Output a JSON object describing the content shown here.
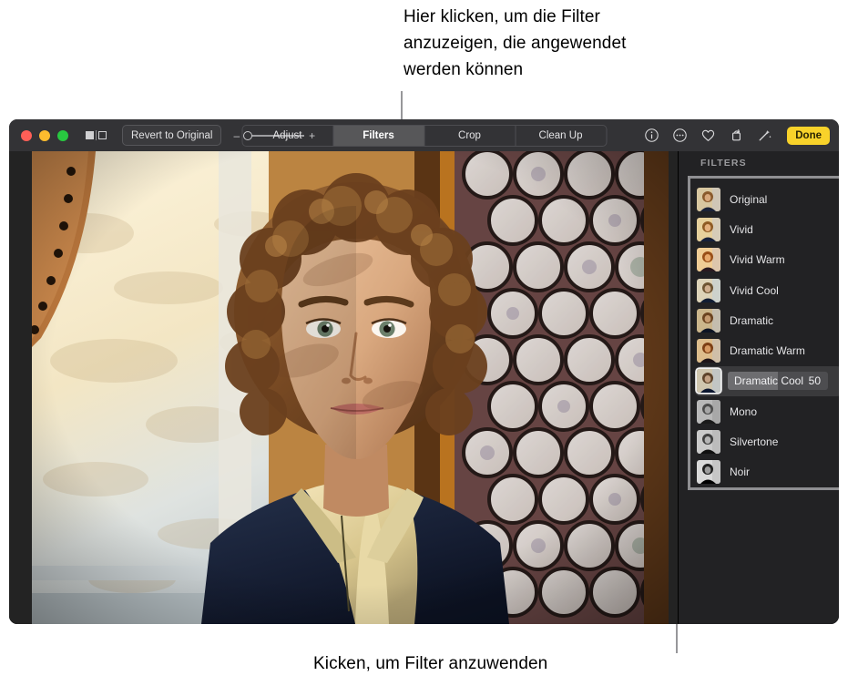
{
  "callouts": {
    "top": "Hier klicken, um die Filter\nanzuzeigen, die angewendet\nwerden können",
    "bottom": "Kicken, um Filter anzuwenden"
  },
  "window": {
    "toolbar": {
      "traffic_lights": [
        "close",
        "minimize",
        "zoom"
      ],
      "split_view_icon": "split-view-icon",
      "revert_label": "Revert to Original",
      "zoom_minus": "–",
      "zoom_plus": "+",
      "zoom_value": 0,
      "segments": [
        {
          "label": "Adjust",
          "active": false
        },
        {
          "label": "Filters",
          "active": true
        },
        {
          "label": "Crop",
          "active": false
        },
        {
          "label": "Clean Up",
          "active": false
        }
      ],
      "icons": [
        "info-icon",
        "more-options-icon",
        "favorite-heart-icon",
        "rotate-icon",
        "magic-wand-icon"
      ],
      "done_label": "Done"
    },
    "side_panel": {
      "title": "FILTERS",
      "filters": [
        {
          "name": "Original",
          "selected": false
        },
        {
          "name": "Vivid",
          "selected": false
        },
        {
          "name": "Vivid Warm",
          "selected": false
        },
        {
          "name": "Vivid Cool",
          "selected": false
        },
        {
          "name": "Dramatic",
          "selected": false
        },
        {
          "name": "Dramatic Warm",
          "selected": false
        },
        {
          "name": "Dramatic Cool",
          "selected": true,
          "value": "50",
          "slider_percent": 50
        },
        {
          "name": "Mono",
          "selected": false
        },
        {
          "name": "Silvertone",
          "selected": false
        },
        {
          "name": "Noir",
          "selected": false
        }
      ]
    },
    "photo": {
      "description": "portrait-photo"
    }
  },
  "colors": {
    "accent_done": "#f8d22a",
    "toolbar_bg": "#333336",
    "panel_bg": "#222224",
    "selected_row_bg": "#3a3a3c"
  }
}
